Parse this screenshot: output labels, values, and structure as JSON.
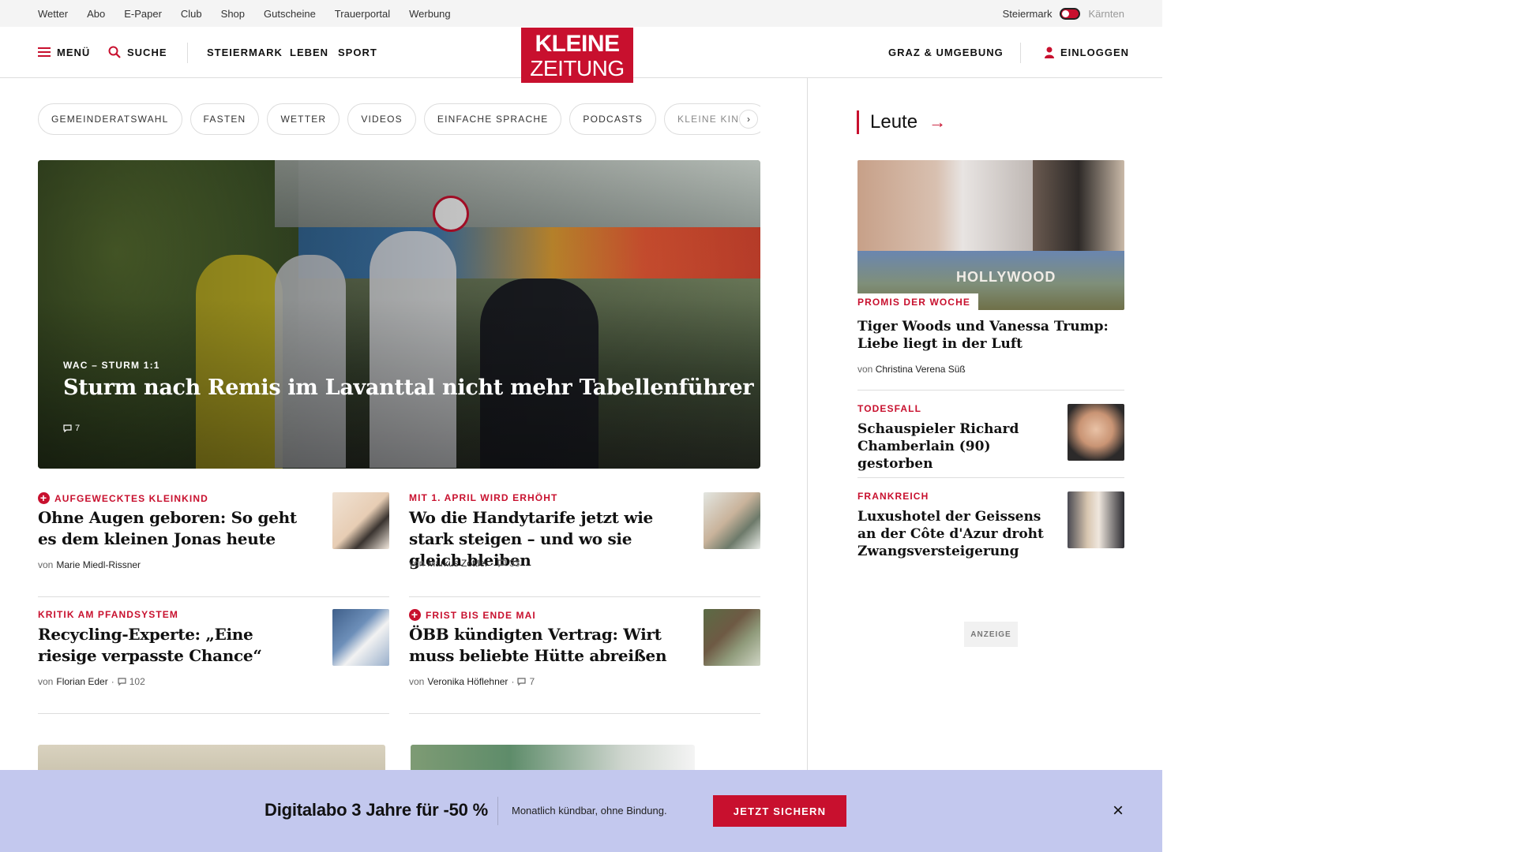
{
  "utilbar": {
    "links": [
      "Wetter",
      "Abo",
      "E-Paper",
      "Club",
      "Shop",
      "Gutscheine",
      "Trauerportal",
      "Werbung"
    ],
    "region_left": "Steiermark",
    "region_right": "Kärnten"
  },
  "header": {
    "menu_label": "MENÜ",
    "search_label": "SUCHE",
    "nav": [
      "STEIERMARK",
      "LEBEN",
      "SPORT"
    ],
    "logo_line1": "KLEINE",
    "logo_line2": "ZEITUNG",
    "location_label": "GRAZ & UMGEBUNG",
    "login_label": "EINLOGGEN"
  },
  "chips": [
    "GEMEINDERATSWAHL",
    "FASTEN",
    "WETTER",
    "VIDEOS",
    "EINFACHE SPRACHE",
    "PODCASTS",
    "KLEINE KINDE"
  ],
  "chips_next": "›",
  "hero": {
    "kicker": "WAC – STURM 1:1",
    "title": "Sturm nach Remis im Lavanttal nicht mehr Tabellenführer",
    "comments": "7"
  },
  "teasers": [
    {
      "kicker": "AUFGEWECKTES KLEINKIND",
      "premium": true,
      "title": "Ohne Augen geboren: So geht es dem kleinen Jonas heute",
      "by_prefix": "von",
      "author": "Marie Miedl-Rissner",
      "comments": ""
    },
    {
      "kicker": "MIT 1. APRIL WIRD ERHÖHT",
      "premium": false,
      "title": "Wo die Handytarife jetzt wie stark steigen – und wo sie gleich bleiben",
      "by_prefix": "von",
      "author": "Markus Zottler",
      "comments": "33"
    },
    {
      "kicker": "KRITIK AM PFANDSYSTEM",
      "premium": false,
      "title": "Recycling-Experte: „Eine riesige verpasste Chance“",
      "by_prefix": "von",
      "author": "Florian Eder",
      "comments": "102"
    },
    {
      "kicker": "FRIST BIS ENDE MAI",
      "premium": true,
      "title": "ÖBB kündigten Vertrag: Wirt muss beliebte Hütte abreißen",
      "by_prefix": "von",
      "author": "Veronika Höflehner",
      "comments": "7"
    }
  ],
  "sidebar": {
    "section_title": "Leute",
    "section_arrow": "→",
    "promi": {
      "image_text": "HOLLYWOOD",
      "kicker": "PROMIS DER WOCHE",
      "title": "Tiger Woods und Vanessa Trump: Liebe liegt in der Luft",
      "by_prefix": "von",
      "author": "Christina Verena Süß"
    },
    "items": [
      {
        "kicker": "TODESFALL",
        "title": "Schauspieler Richard Chamberlain (90) gestorben"
      },
      {
        "kicker": "FRANKREICH",
        "title": "Luxushotel der Geissens an der Côte d'Azur droht Zwangsversteigerung"
      }
    ],
    "ad_label": "ANZEIGE"
  },
  "promo": {
    "headline": "Digitalabo 3 Jahre für -50 %",
    "subtext": "Monatlich kündbar, ohne Bindung.",
    "cta": "JETZT SICHERN",
    "close": "×"
  },
  "colors": {
    "brand_red": "#c8102e",
    "promo_bg": "#c3c8ee",
    "utilbar_bg": "#f4f4f4"
  },
  "icons": [
    "hamburger-icon",
    "search-icon",
    "user-icon",
    "comment-icon",
    "plus-icon",
    "arrow-right-icon",
    "close-icon",
    "chevron-right-icon"
  ]
}
